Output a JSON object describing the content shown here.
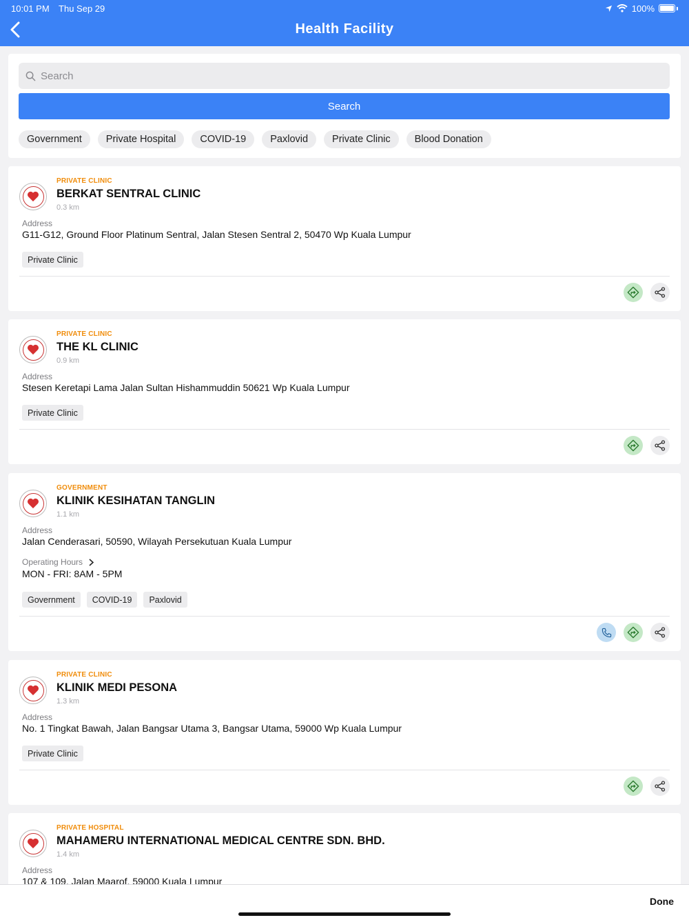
{
  "status_bar": {
    "time": "10:01 PM",
    "date": "Thu Sep 29",
    "battery": "100%"
  },
  "header": {
    "title": "Health Facility"
  },
  "search": {
    "placeholder": "Search",
    "value": "",
    "button_label": "Search"
  },
  "filters": [
    "Government",
    "Private Hospital",
    "COVID-19",
    "Paxlovid",
    "Private Clinic",
    "Blood Donation"
  ],
  "labels": {
    "address": "Address",
    "operating_hours": "Operating Hours"
  },
  "facilities": [
    {
      "category": "PRIVATE CLINIC",
      "name": "BERKAT SENTRAL CLINIC",
      "distance": "0.3 km",
      "address": "G11-G12, Ground Floor Platinum Sentral, Jalan Stesen Sentral 2, 50470 Wp Kuala Lumpur",
      "tags": [
        "Private Clinic"
      ]
    },
    {
      "category": "PRIVATE CLINIC",
      "name": "THE KL CLINIC",
      "distance": "0.9 km",
      "address": "Stesen Keretapi Lama Jalan Sultan Hishammuddin 50621 Wp Kuala Lumpur",
      "tags": [
        "Private Clinic"
      ]
    },
    {
      "category": "GOVERNMENT",
      "name": "KLINIK KESIHATAN TANGLIN",
      "distance": "1.1 km",
      "address": "Jalan Cenderasari, 50590, Wilayah Persekutuan Kuala Lumpur",
      "operating_hours": "MON - FRI: 8AM - 5PM",
      "tags": [
        "Government",
        "COVID-19",
        "Paxlovid"
      ]
    },
    {
      "category": "PRIVATE CLINIC",
      "name": "KLINIK MEDI PESONA",
      "distance": "1.3 km",
      "address": "No. 1 Tingkat Bawah, Jalan Bangsar Utama 3, Bangsar Utama, 59000 Wp Kuala Lumpur",
      "tags": [
        "Private Clinic"
      ]
    },
    {
      "category": "PRIVATE HOSPITAL",
      "name": "MAHAMERU INTERNATIONAL MEDICAL CENTRE SDN. BHD.",
      "distance": "1.4 km",
      "address": "107 & 109, Jalan Maarof, 59000 Kuala Lumpur"
    }
  ],
  "keyboard_toolbar": {
    "done_label": "Done"
  },
  "colors": {
    "primary": "#3b82f6",
    "category": "#f08c0a",
    "directions_bg": "#c4e8c6",
    "call_bg": "#bfdcf3"
  }
}
